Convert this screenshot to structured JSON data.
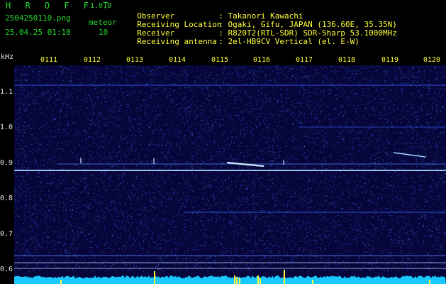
{
  "header": {
    "title": "H R O F F T",
    "version": "1.0.0",
    "filename": "2504250110.png",
    "datetime": "25.04.25 01:10",
    "meteor_label": "meteor",
    "meteor_count": "10"
  },
  "meta": [
    {
      "label": "Observer",
      "value": ": Takanori Kawachi"
    },
    {
      "label": "Receiving Location",
      "value": ": Ogaki, Gifu, JAPAN (136.60E, 35.35N)"
    },
    {
      "label": "Receiver",
      "value": ": R820T2(RTL-SDR) SDR-Sharp 53.1000MHz"
    },
    {
      "label": "Receiving antenna",
      "value": ": 2el-HB9CV Vertical (el. E-W)"
    }
  ],
  "axis": {
    "y_unit": "kHz",
    "y_ticks": [
      "1.1",
      "1.0",
      "0.9",
      "0.8",
      "0.7",
      "0.6"
    ],
    "x_ticks": [
      "0111",
      "0112",
      "0113",
      "0114",
      "0115",
      "0116",
      "0117",
      "0118",
      "0119",
      "0120"
    ]
  },
  "colors": {
    "background": "#000000",
    "spectro_bg": "#06063a",
    "noise": "#2f4ad8",
    "signal": "#9fd8ff",
    "baseline": "#18c8ff",
    "marker": "#ffff3a"
  }
}
